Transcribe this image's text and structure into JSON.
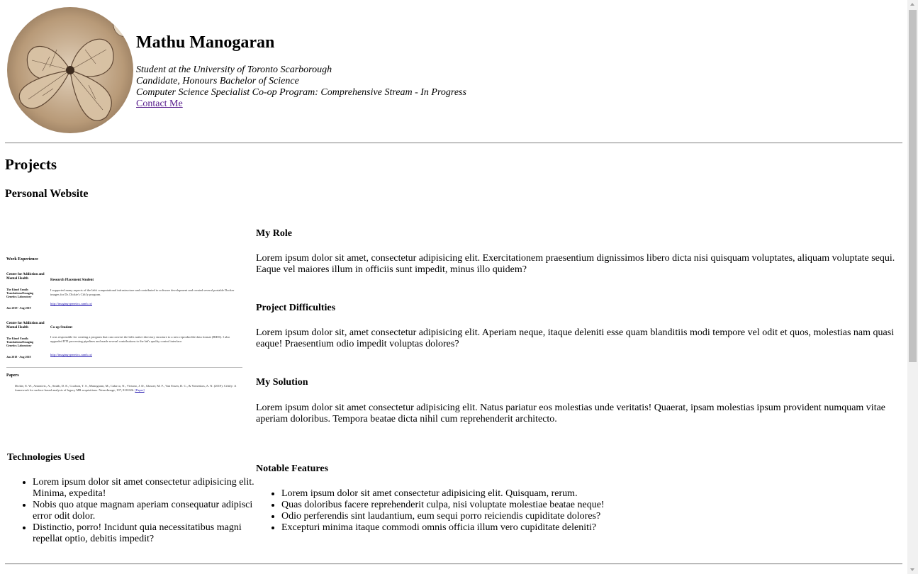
{
  "header": {
    "name": "Mathu Manogaran",
    "bio_lines": [
      "Student at the University of Toronto Scarborough",
      "Candidate, Honours Bachelor of Science",
      "Computer Science Specialist Co-op Program: Comprehensive Stream - In Progress"
    ],
    "contact_link": "Contact Me"
  },
  "projects": {
    "title": "Projects",
    "items": [
      {
        "title": "Personal Website",
        "thumbnail": {
          "work_heading": "Work Experience",
          "job1": {
            "org": "Centre for Addiction and Mental Health",
            "lab": "The Kimel Family Translational Imaging Genetics Laboratory",
            "dates": "Jun 2019 - Aug 2019",
            "role": "Research Placement Student",
            "desc": "I supported many aspects of the lab's computational infrastructure and contributed to software development and created several portable Docker images for Dr. Dickie's Cifti'y program.",
            "link": "http://imaging-genetics.camh.ca/"
          },
          "job2": {
            "org": "Centre for Addiction and Mental Health",
            "lab": "The Kimel Family Translational Imaging Genetics Laboratory",
            "dates": "Jan 2018 - Aug 2018",
            "role": "Co-op Student",
            "desc": "I was responsible for creating a program that can convert the lab's native directory structure to a new reproducible data format (BIDS). I also upgraded DTI processing pipelines and made several contributions to the lab's quality control interface.",
            "link": "http://imaging-genetics.camh.ca/"
          },
          "papers_heading": "Papers",
          "paper": "Dickie, E. W., Antonivic, A., Smith, D. E., Coalson, T. S., Manogaran, M., Calarco, N., Viviano, J. D., Glasser, M. F., Van Essen, D. C., & Voineskos, A. N. (2019). Ciftify: A framework for surface-based analysis of legacy MR acquisitions. NeuroImage, 197, 818-826.",
          "paper_link": "[Paper]"
        },
        "technologies": {
          "heading": "Technologies Used",
          "items": [
            "Lorem ipsum dolor sit amet consectetur adipisicing elit. Minima, expedita!",
            "Nobis quo atque magnam aperiam consequatur adipisci error odit dolor.",
            "Distinctio, porro! Incidunt quia necessitatibus magni repellat optio, debitis impedit?"
          ]
        },
        "role": {
          "heading": "My Role",
          "text": "Lorem ipsum dolor sit amet, consectetur adipisicing elit. Exercitationem praesentium dignissimos libero dicta nisi quisquam voluptates, aliquam voluptate sequi. Eaque vel maiores illum in officiis sunt impedit, minus illo quidem?"
        },
        "difficulties": {
          "heading": "Project Difficulties",
          "text": "Lorem ipsum dolor sit, amet consectetur adipisicing elit. Aperiam neque, itaque deleniti esse quam blanditiis modi tempore vel odit et quos, molestias nam quasi eaque! Praesentium odio impedit voluptas dolores?"
        },
        "solution": {
          "heading": "My Solution",
          "text": "Lorem ipsum dolor sit amet consectetur adipisicing elit. Natus pariatur eos molestias unde veritatis! Quaerat, ipsam molestias ipsum provident numquam vitae aperiam doloribus. Tempora beatae dicta nihil cum reprehenderit architecto."
        },
        "features": {
          "heading": "Notable Features",
          "items": [
            "Lorem ipsum dolor sit amet consectetur adipisicing elit. Quisquam, rerum.",
            "Quas doloribus facere reprehenderit culpa, nisi voluptate molestiae beatae neque!",
            "Odio perferendis sint laudantium, eum sequi porro reiciendis cupiditate dolores?",
            "Excepturi minima itaque commodi omnis officia illum vero cupiditate deleniti?"
          ]
        }
      }
    ]
  },
  "colors": {
    "link_visited": "#551a8b",
    "rule": "#9a9a9a",
    "avatar_tone": "#c9ae8f"
  }
}
